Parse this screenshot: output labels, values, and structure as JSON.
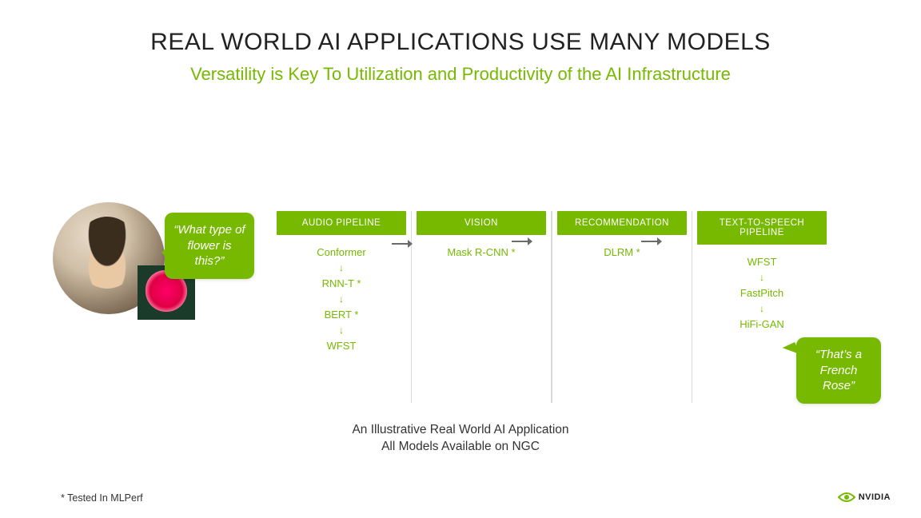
{
  "title": "REAL WORLD AI APPLICATIONS USE MANY MODELS",
  "subtitle": "Versatility is Key To Utilization and Productivity of the AI Infrastructure",
  "input_bubble": "“What type of flower is this?”",
  "output_bubble": "“That’s a French Rose”",
  "pipelines": [
    {
      "header": "AUDIO PIPELINE",
      "models": [
        "Conformer",
        "RNN-T *",
        "BERT *",
        "WFST"
      ]
    },
    {
      "header": "VISION",
      "models": [
        "Mask R-CNN *"
      ]
    },
    {
      "header": "RECOMMENDATION",
      "models": [
        "DLRM *"
      ]
    },
    {
      "header": "TEXT-TO-SPEECH PIPELINE",
      "models": [
        "WFST",
        "FastPitch",
        "HiFi-GAN"
      ]
    }
  ],
  "caption_line1": "An Illustrative Real World AI Application",
  "caption_line2": "All Models Available on NGC",
  "footnote": "* Tested In MLPerf",
  "logo_text": "NVIDIA"
}
